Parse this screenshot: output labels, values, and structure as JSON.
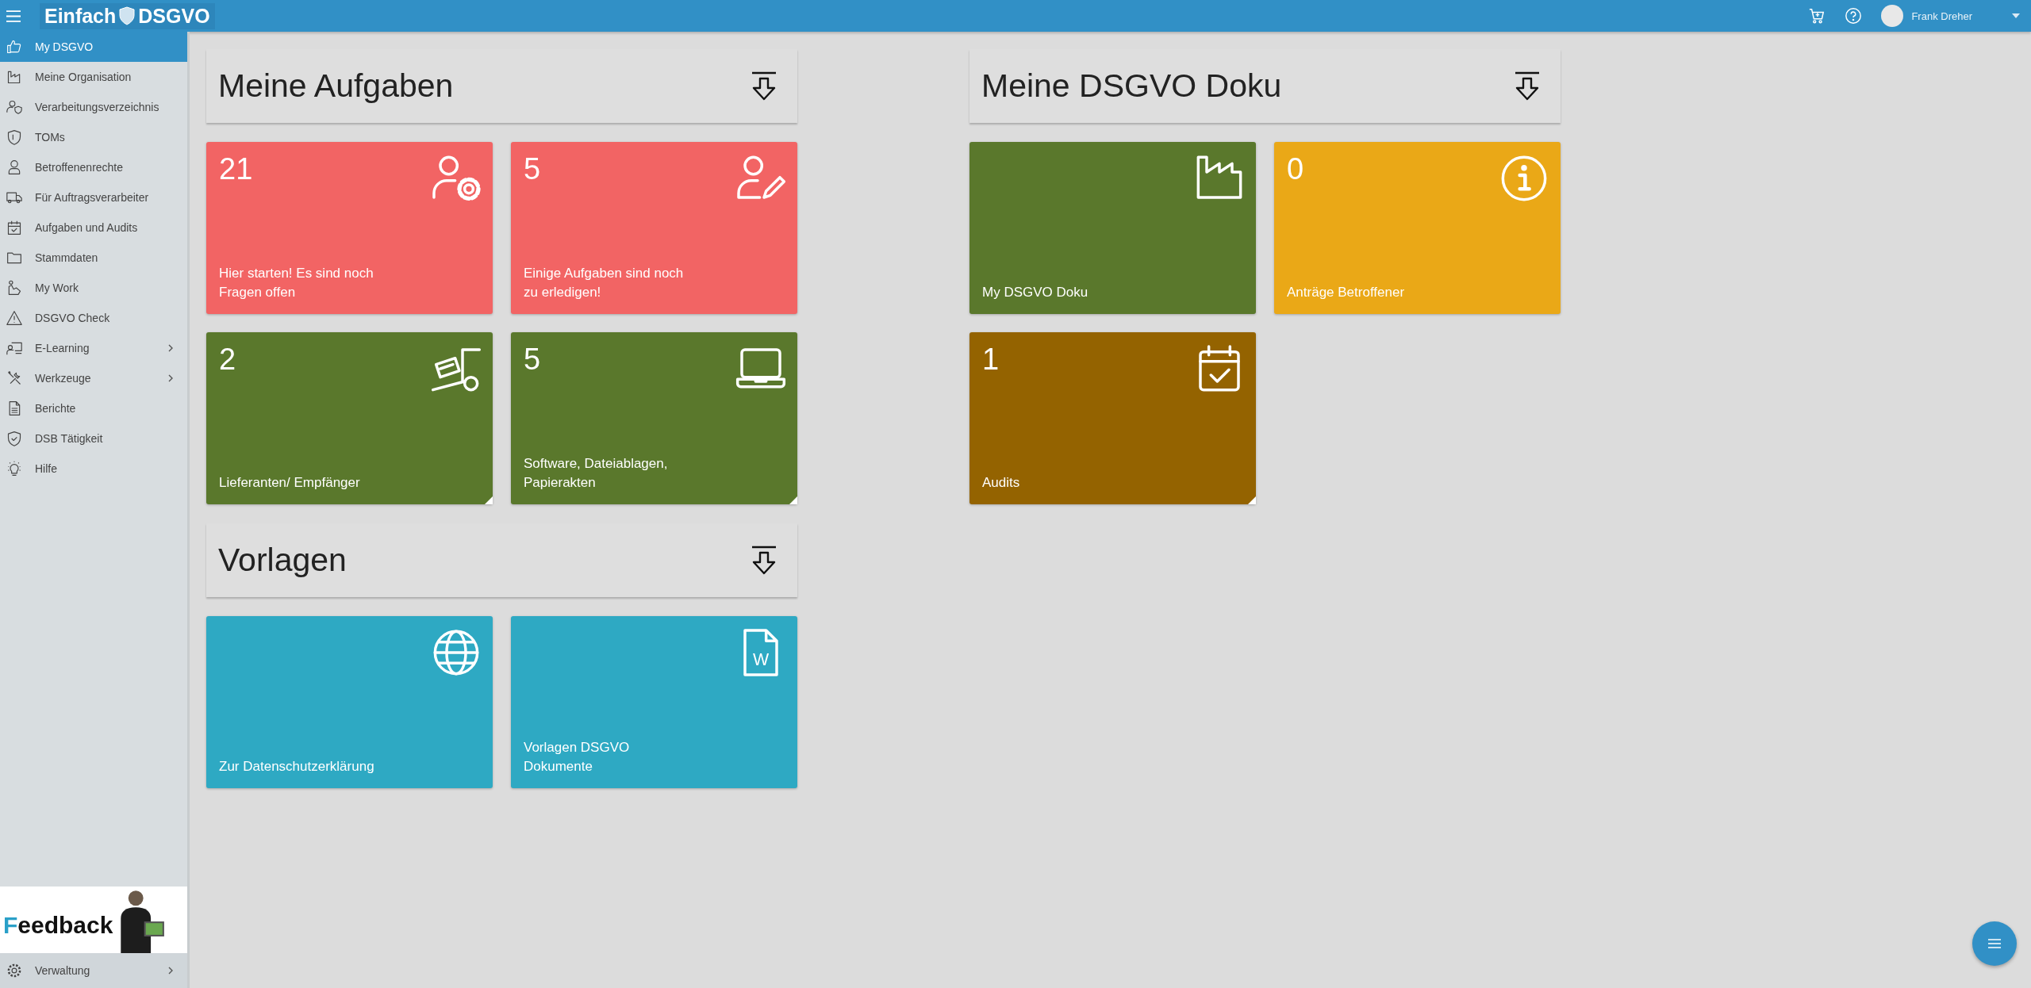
{
  "topbar": {
    "logo_left": "Einfach",
    "logo_right": "DSGVO",
    "user_name": "Frank Dreher"
  },
  "sidebar": {
    "items": [
      {
        "label": "My DSGVO",
        "selected": true,
        "has_submenu": false
      },
      {
        "label": "Meine Organisation",
        "selected": false,
        "has_submenu": false
      },
      {
        "label": "Verarbeitungsverzeichnis",
        "selected": false,
        "has_submenu": false
      },
      {
        "label": "TOMs",
        "selected": false,
        "has_submenu": false
      },
      {
        "label": "Betroffenenrechte",
        "selected": false,
        "has_submenu": false
      },
      {
        "label": "Für Auftragsverarbeiter",
        "selected": false,
        "has_submenu": false
      },
      {
        "label": "Aufgaben und Audits",
        "selected": false,
        "has_submenu": false
      },
      {
        "label": "Stammdaten",
        "selected": false,
        "has_submenu": false
      },
      {
        "label": "My Work",
        "selected": false,
        "has_submenu": false
      },
      {
        "label": "DSGVO Check",
        "selected": false,
        "has_submenu": false
      },
      {
        "label": "E-Learning",
        "selected": false,
        "has_submenu": true
      },
      {
        "label": "Werkzeuge",
        "selected": false,
        "has_submenu": true
      },
      {
        "label": "Berichte",
        "selected": false,
        "has_submenu": false
      },
      {
        "label": "DSB Tätigkeit",
        "selected": false,
        "has_submenu": false
      },
      {
        "label": "Hilfe",
        "selected": false,
        "has_submenu": false
      }
    ],
    "feedback_banner": {
      "text": "Feedback"
    },
    "footer_item": {
      "label": "Verwaltung",
      "has_submenu": true
    }
  },
  "columns": [
    {
      "sections": [
        {
          "title": "Meine Aufgaben",
          "tiles": [
            {
              "count": "21",
              "label": "Hier starten! Es sind noch\nFragen offen",
              "color": "#f26464",
              "corner_mark": false
            },
            {
              "count": "5",
              "label": "Einige Aufgaben sind noch\nzu erledigen!",
              "color": "#f26464",
              "corner_mark": false
            },
            {
              "count": "2",
              "label": "Lieferanten/ Empfänger",
              "color": "#5a782c",
              "corner_mark": true
            },
            {
              "count": "5",
              "label": "Software, Dateiablagen,\nPapierakten",
              "color": "#5a782c",
              "corner_mark": true
            }
          ]
        },
        {
          "title": "Vorlagen",
          "tiles": [
            {
              "label": "Zur Datenschutzerklärung",
              "color": "#2ea9c3",
              "corner_mark": false
            },
            {
              "label": "Vorlagen DSGVO\nDokumente",
              "color": "#2ea9c3",
              "corner_mark": false,
              "icon_text": "W"
            }
          ]
        }
      ]
    },
    {
      "sections": [
        {
          "title": "Meine DSGVO Doku",
          "tiles": [
            {
              "label": "My DSGVO Doku",
              "color": "#5a782c",
              "corner_mark": false
            },
            {
              "count": "0",
              "label": "Anträge Betroffener",
              "color": "#eaa817",
              "corner_mark": false
            },
            {
              "count": "1",
              "label": "Audits",
              "color": "#946300",
              "corner_mark": true
            }
          ]
        }
      ]
    }
  ]
}
